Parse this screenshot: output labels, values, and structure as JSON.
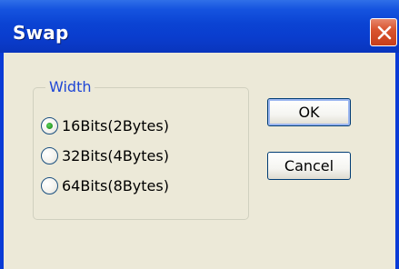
{
  "window": {
    "title": "Swap"
  },
  "width_group": {
    "label": "Width",
    "options": [
      {
        "label": "16Bits(2Bytes)",
        "selected": true
      },
      {
        "label": "32Bits(4Bytes)",
        "selected": false
      },
      {
        "label": "64Bits(8Bytes)",
        "selected": false
      }
    ]
  },
  "buttons": {
    "ok_label": "OK",
    "cancel_label": "Cancel"
  },
  "colors": {
    "title_bar": "#0a3dce",
    "client_bg": "#ece9d8",
    "group_label": "#1f47d6",
    "close_button": "#d9542f",
    "radio_selected": "#2ea02b"
  },
  "icons": {
    "close": "close-icon"
  }
}
